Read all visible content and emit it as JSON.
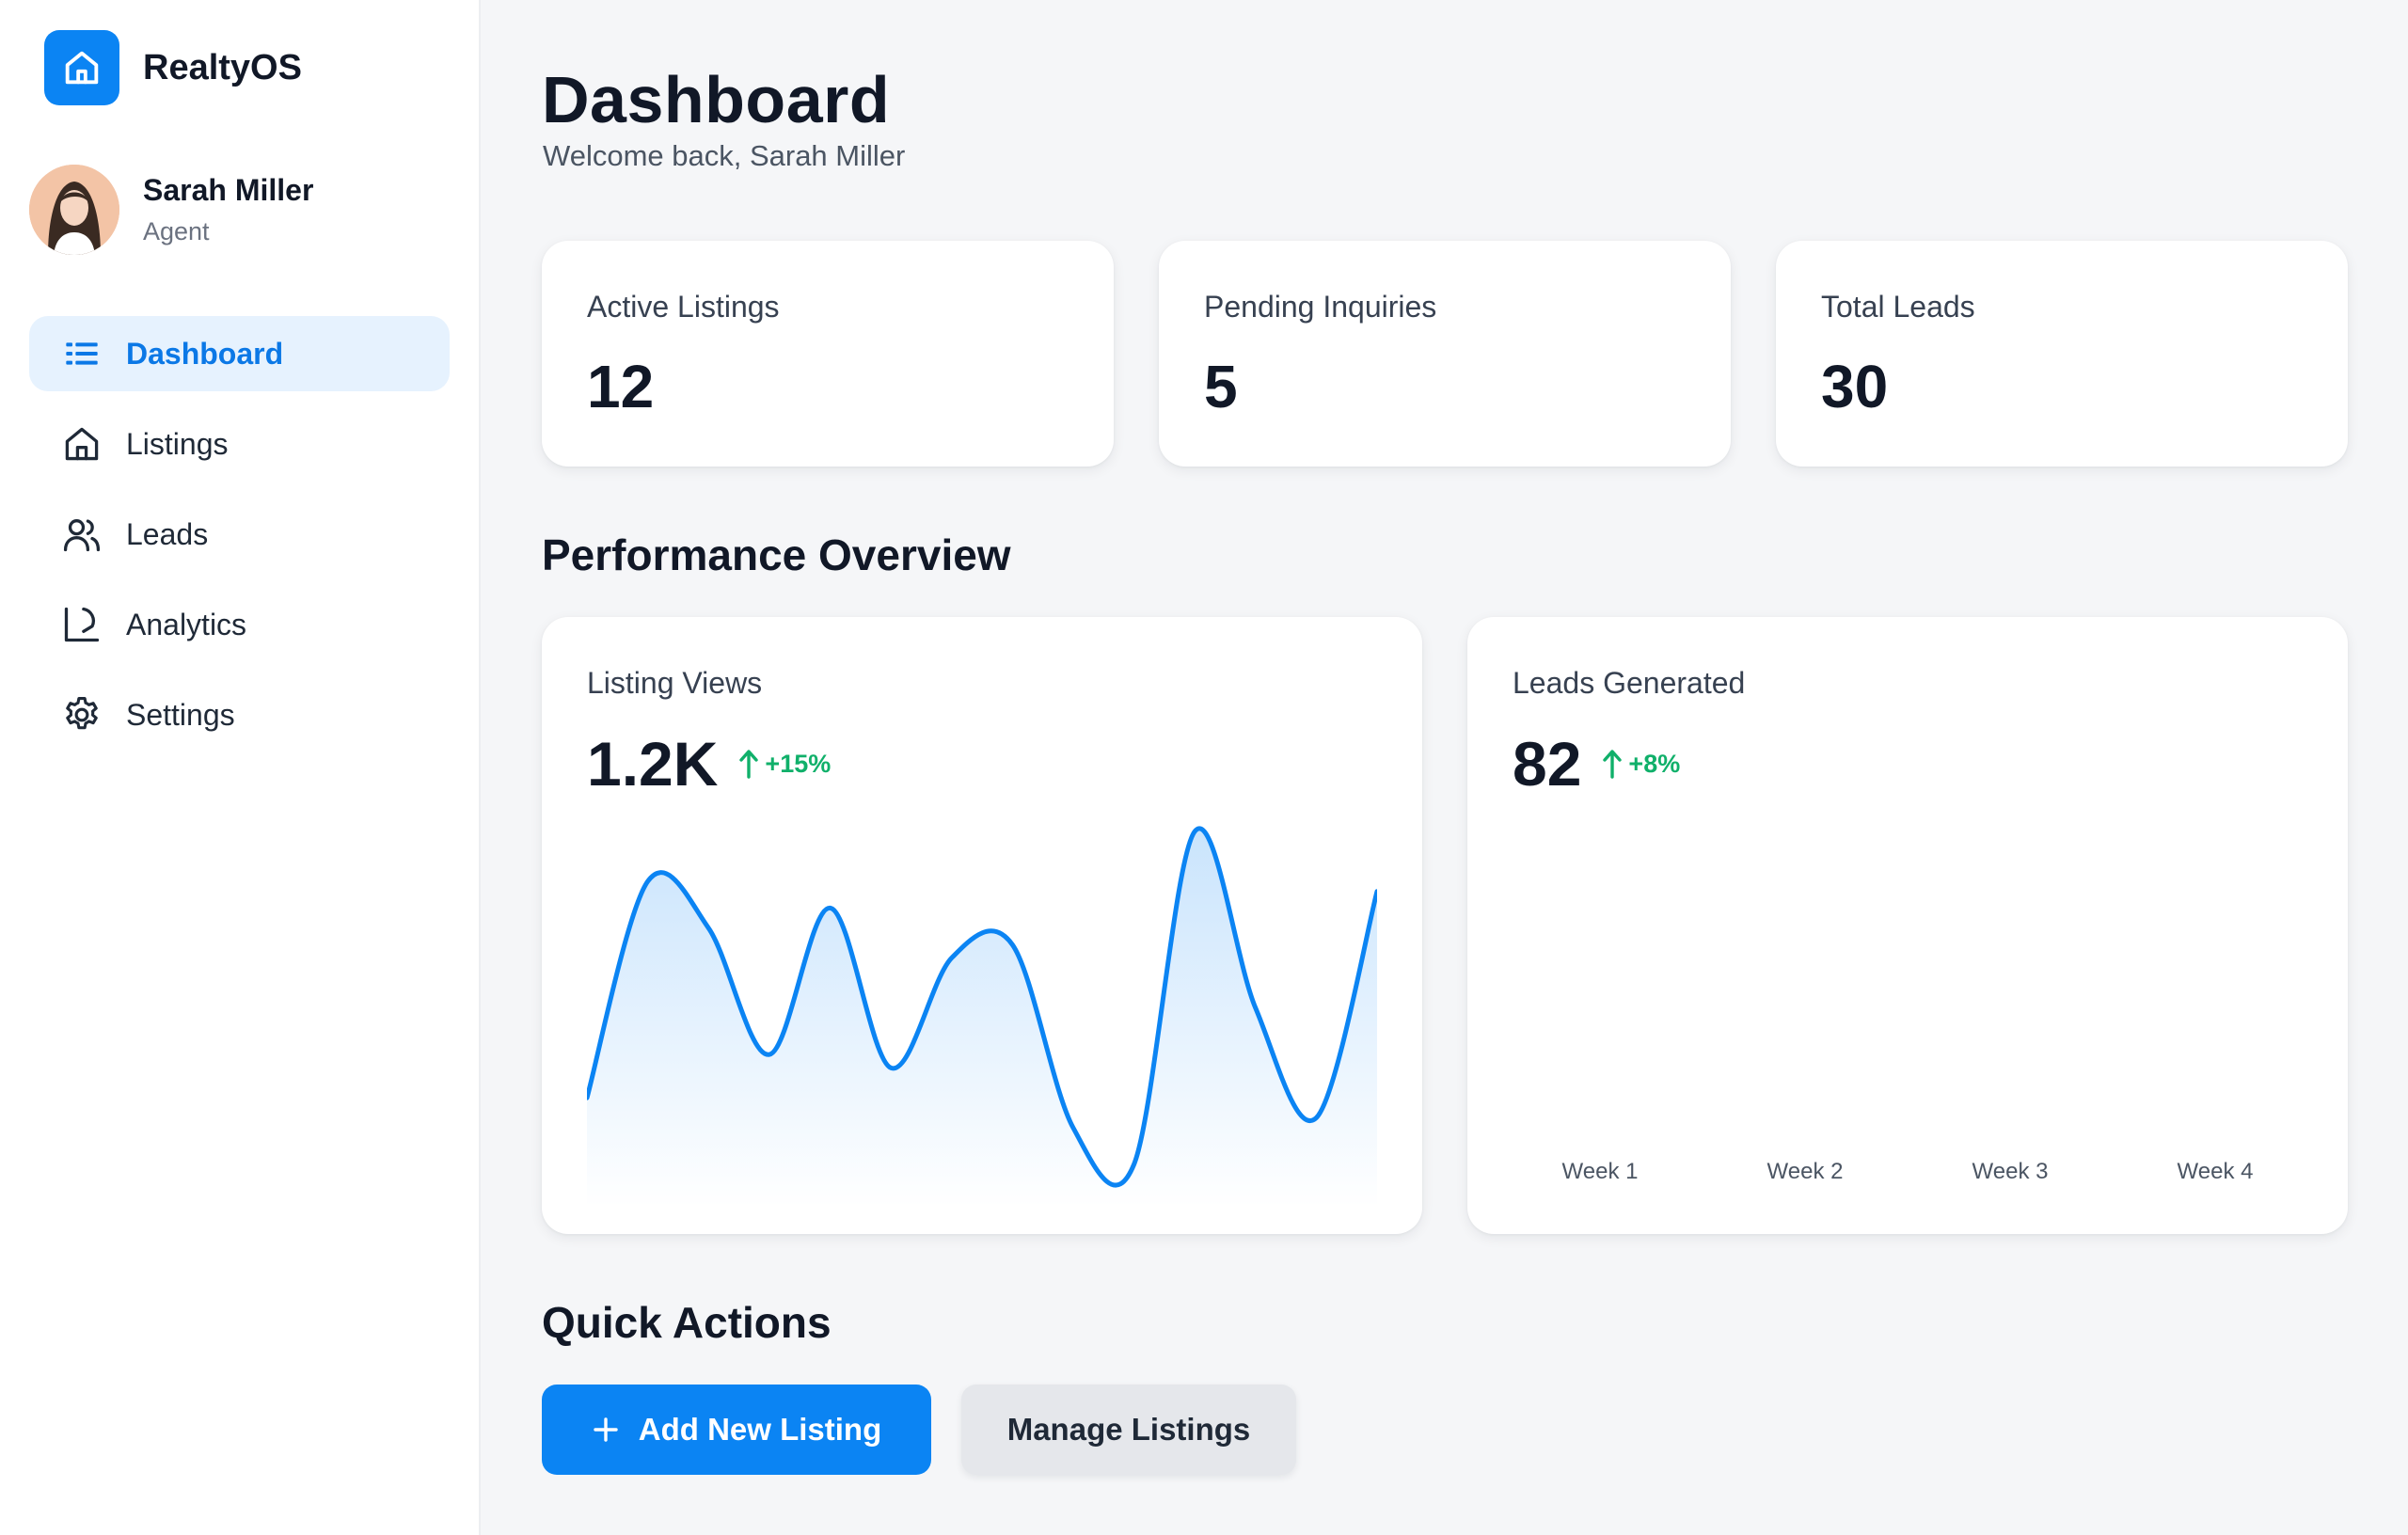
{
  "app": {
    "name": "RealtyOS",
    "logo_icon": "home-icon",
    "accent": "#0b84f3"
  },
  "user": {
    "name": "Sarah Miller",
    "role": "Agent"
  },
  "nav": [
    {
      "label": "Dashboard",
      "icon": "dashboard-list-icon",
      "active": true
    },
    {
      "label": "Listings",
      "icon": "home-icon",
      "active": false
    },
    {
      "label": "Leads",
      "icon": "users-icon",
      "active": false
    },
    {
      "label": "Analytics",
      "icon": "analytics-icon",
      "active": false
    },
    {
      "label": "Settings",
      "icon": "gear-icon",
      "active": false
    }
  ],
  "header": {
    "title": "Dashboard",
    "subtitle": "Welcome back, Sarah Miller"
  },
  "stats": [
    {
      "label": "Active Listings",
      "value": "12"
    },
    {
      "label": "Pending Inquiries",
      "value": "5"
    },
    {
      "label": "Total Leads",
      "value": "30"
    }
  ],
  "performance": {
    "title": "Performance Overview",
    "listing_views": {
      "label": "Listing Views",
      "value": "1.2K",
      "delta": "+15%"
    },
    "leads_generated": {
      "label": "Leads Generated",
      "value": "82",
      "delta": "+8%"
    }
  },
  "quick_actions": {
    "title": "Quick Actions",
    "add_label": "Add New Listing",
    "manage_label": "Manage Listings"
  },
  "chart_data": [
    {
      "type": "area",
      "title": "Listing Views",
      "x": [
        0,
        1,
        2,
        3,
        4,
        5,
        6,
        7,
        8,
        9,
        10,
        11,
        12,
        13
      ],
      "values": [
        20,
        85,
        71,
        33,
        77,
        29,
        62,
        66,
        11,
        0,
        100,
        47,
        14,
        82
      ],
      "ylim": [
        0,
        100
      ],
      "color": "#0b84f3"
    },
    {
      "type": "bar",
      "title": "Leads Generated",
      "categories": [
        "Week 1",
        "Week 2",
        "Week 3",
        "Week 4"
      ],
      "values": []
    }
  ]
}
